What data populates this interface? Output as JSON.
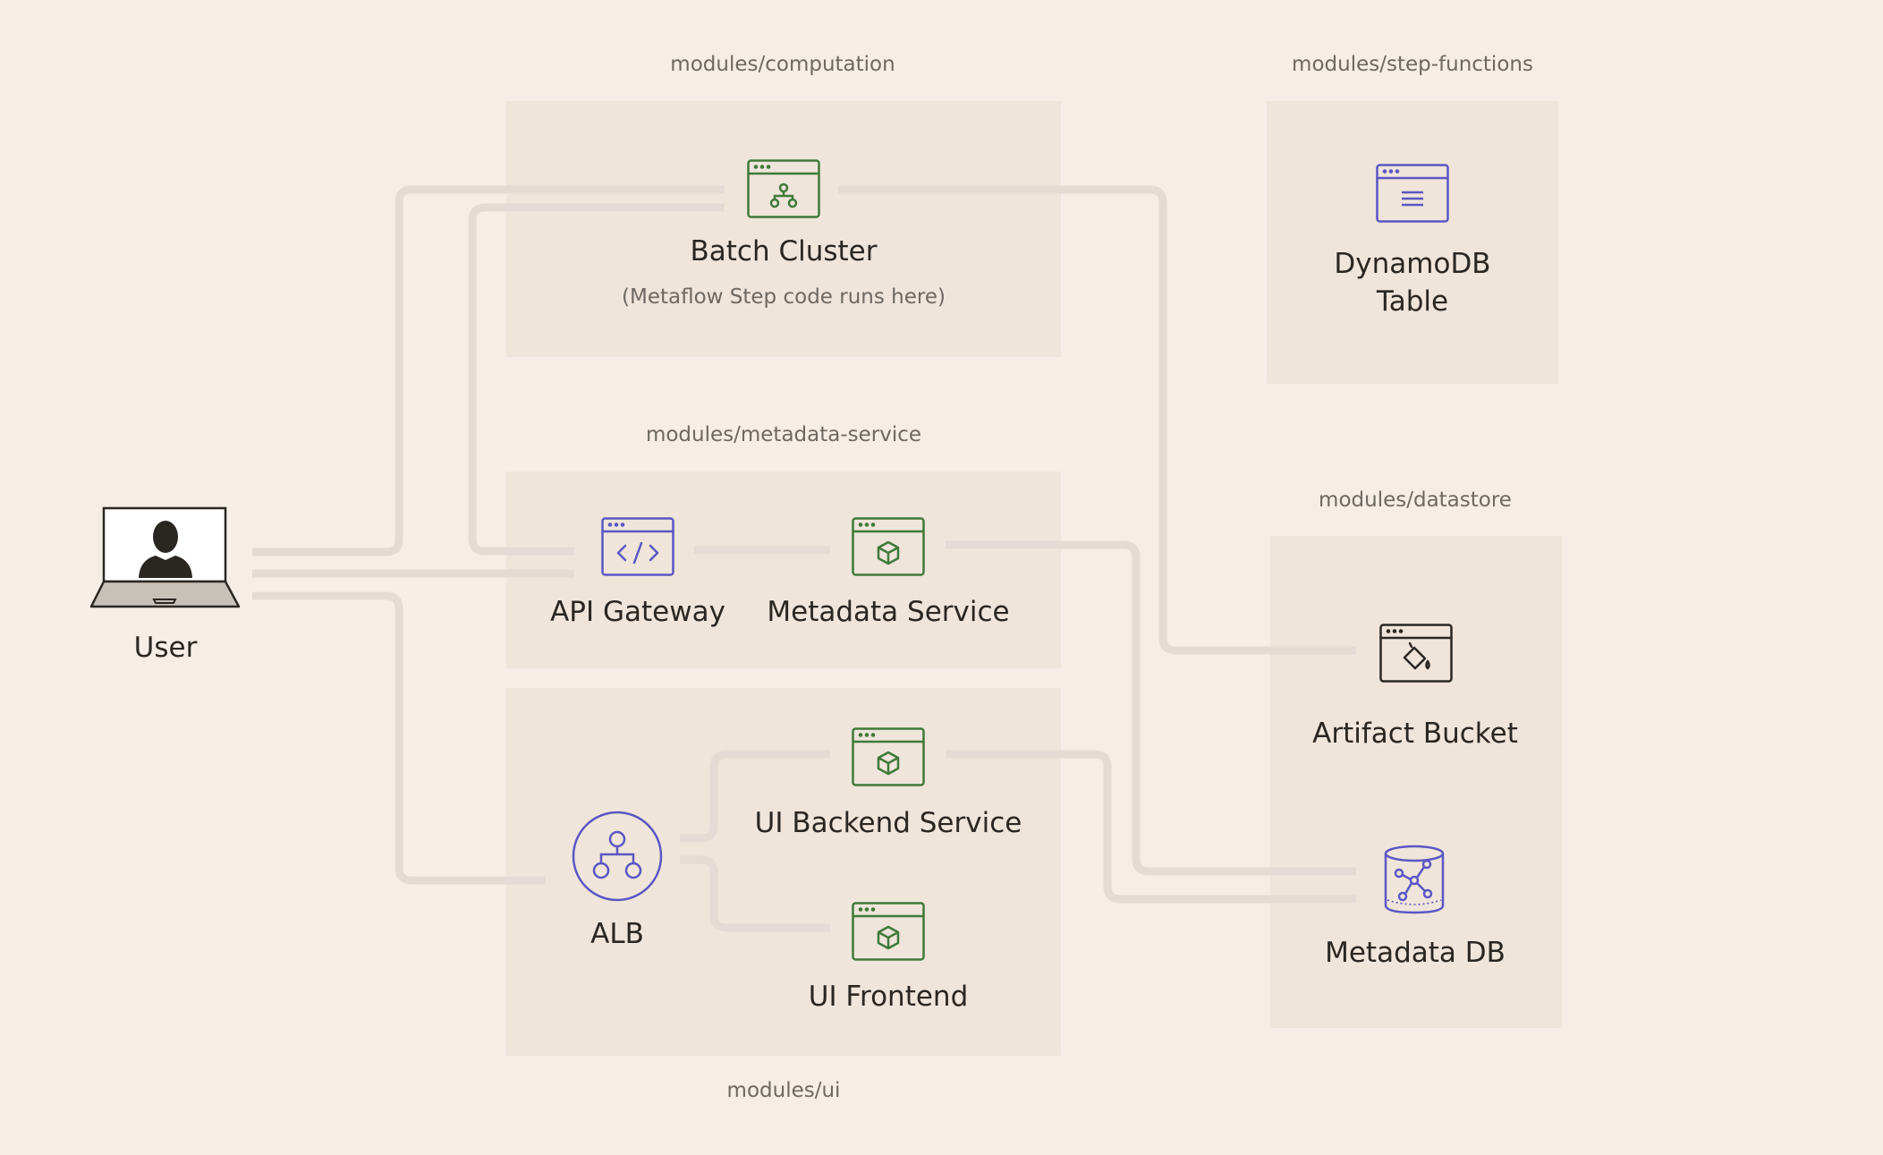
{
  "modules": {
    "computation": "modules/computation",
    "step_functions": "modules/step-functions",
    "metadata_service": "modules/metadata-service",
    "datastore": "modules/datastore",
    "ui": "modules/ui"
  },
  "nodes": {
    "batch_cluster": {
      "label": "Batch Cluster",
      "sublabel": "(Metaflow Step code runs here)",
      "icon": "batch-cluster-icon"
    },
    "dynamodb_line1": "DynamoDB",
    "dynamodb_line2": "Table",
    "user": {
      "label": "User",
      "icon": "user-laptop-icon"
    },
    "api_gateway": {
      "label": "API Gateway",
      "icon": "code-window-icon"
    },
    "metadata_service": {
      "label": "Metadata Service",
      "icon": "container-window-icon"
    },
    "artifact_bucket": {
      "label": "Artifact Bucket",
      "icon": "bucket-window-icon"
    },
    "ui_backend": {
      "label": "UI Backend Service",
      "icon": "container-window-icon"
    },
    "ui_frontend": {
      "label": "UI Frontend",
      "icon": "container-window-icon"
    },
    "alb": {
      "label": "ALB",
      "icon": "load-balancer-icon"
    },
    "metadata_db": {
      "label": "Metadata DB",
      "icon": "database-icon"
    }
  },
  "colors": {
    "background": "#f5ede6",
    "module_box": "#efe5da",
    "connector": "#e4dcd4",
    "green": "#3f7a38",
    "purple": "#5a56c4",
    "dark": "#2a2622"
  }
}
